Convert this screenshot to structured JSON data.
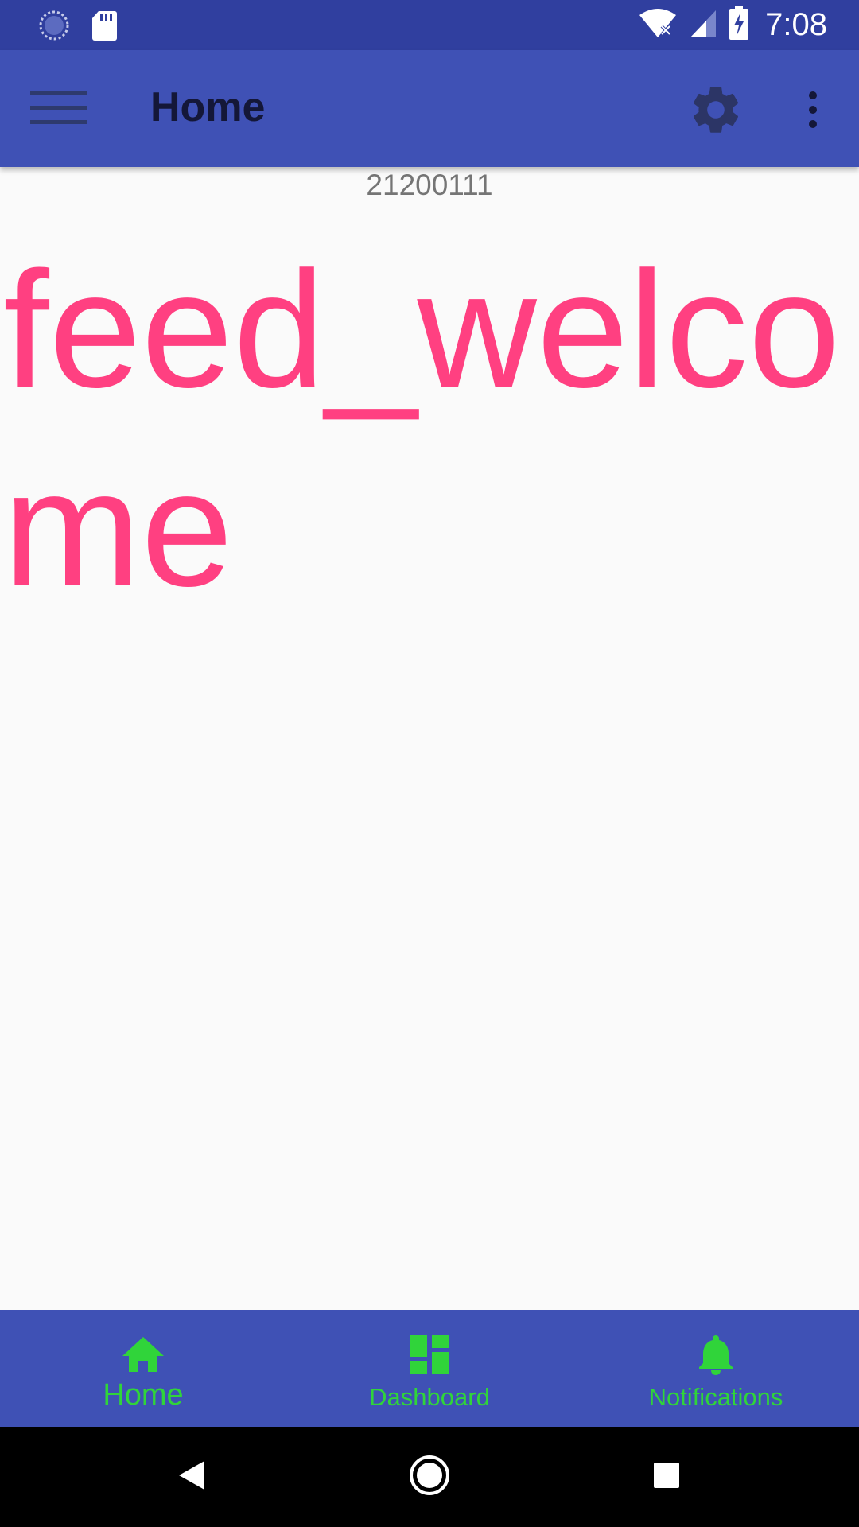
{
  "status_bar": {
    "time": "7:08",
    "icons": [
      "loading-icon",
      "sd-card-icon",
      "wifi-off-icon",
      "cell-signal-icon",
      "battery-charging-icon"
    ]
  },
  "app_bar": {
    "title": "Home",
    "icons": [
      "menu-icon",
      "gear-icon",
      "more-vert-icon"
    ]
  },
  "content": {
    "id_text": "21200111",
    "welcome_text": "feed_welcome"
  },
  "bottom_nav": {
    "items": [
      {
        "label": "Home",
        "icon": "home-icon",
        "active": true
      },
      {
        "label": "Dashboard",
        "icon": "dashboard-icon",
        "active": false
      },
      {
        "label": "Notifications",
        "icon": "bell-icon",
        "active": false
      }
    ]
  },
  "system_nav": {
    "icons": [
      "back-icon",
      "home-circle-icon",
      "recents-icon"
    ]
  },
  "colors": {
    "status_bar": "#303f9f",
    "app_bar": "#3f51b5",
    "accent": "#ff4081",
    "nav_label": "#30d43a",
    "background": "#fafafa"
  }
}
